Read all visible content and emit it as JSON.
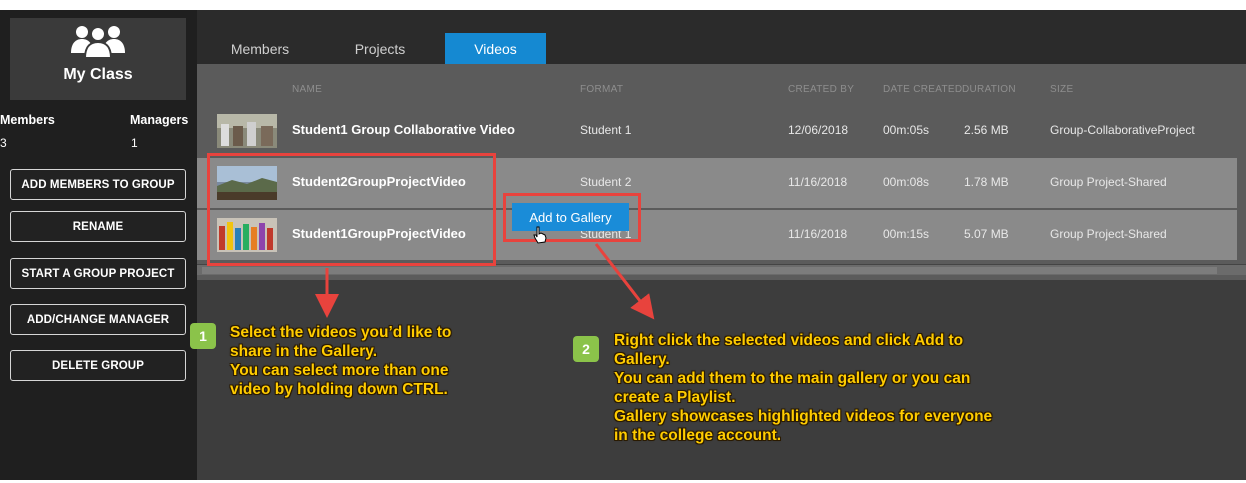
{
  "sidebar": {
    "title": "My Class",
    "members_label": "Members",
    "members_count": "3",
    "managers_label": "Managers",
    "managers_count": "1",
    "buttons": [
      "ADD MEMBERS TO GROUP",
      "RENAME",
      "START A GROUP PROJECT",
      "ADD/CHANGE MANAGER",
      "DELETE GROUP"
    ]
  },
  "tabs": [
    "Members",
    "Projects",
    "Videos"
  ],
  "active_tab": "Videos",
  "columns": [
    "NAME",
    "FORMAT",
    "CREATED BY",
    "DATE CREATED",
    "DURATION",
    "SIZE"
  ],
  "rows": [
    {
      "name": "Student1 Group Collaborative Video",
      "created_by": "Student 1",
      "date": "12/06/2018",
      "duration": "00m:05s",
      "size": "2.56 MB",
      "project": "Group-CollaborativeProject",
      "selected": false
    },
    {
      "name": "Student2GroupProjectVideo",
      "created_by": "Student 2",
      "date": "11/16/2018",
      "duration": "00m:08s",
      "size": "1.78 MB",
      "project": "Group Project-Shared",
      "selected": true
    },
    {
      "name": "Student1GroupProjectVideo",
      "created_by": "Student 1",
      "date": "11/16/2018",
      "duration": "00m:15s",
      "size": "5.07 MB",
      "project": "Group Project-Shared",
      "selected": true
    }
  ],
  "context_menu": {
    "item": "Add to Gallery"
  },
  "callouts": [
    {
      "number": "1",
      "lines": [
        "Select the videos you’d like to",
        "share in the Gallery.",
        "You can select more than one",
        "video by holding down CTRL."
      ]
    },
    {
      "number": "2",
      "lines": [
        "Right click the selected videos and click Add to",
        "Gallery.",
        "You can add them to the main gallery or you can",
        "create a Playlist.",
        "Gallery showcases highlighted videos for everyone",
        "in the college account."
      ]
    }
  ],
  "colors": {
    "accent": "#1589d2",
    "annotation_red": "#e8433d",
    "callout_yellow": "#ffcc00",
    "badge_green": "#8bc34a"
  }
}
